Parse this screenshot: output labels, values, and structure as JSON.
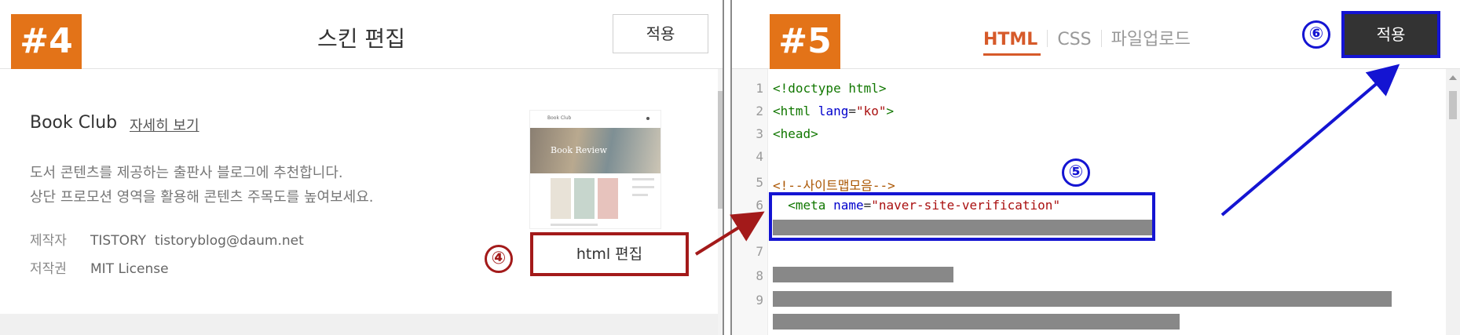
{
  "left_panel": {
    "step_tag": "#4",
    "title": "스킨 편집",
    "apply_label": "적용",
    "skin": {
      "name": "Book Club",
      "detail_link": "자세히 보기",
      "description": [
        "도서 콘텐츠를 제공하는 출판사 블로그에 추천합니다.",
        "상단 프로모션 영역을 활용해 콘텐츠 주목도를 높여보세요."
      ],
      "meta": [
        {
          "label": "제작자",
          "value": "TISTORY  tistoryblog@daum.net"
        },
        {
          "label": "저작권",
          "value": "MIT License"
        }
      ]
    },
    "thumbnail": {
      "header_text": "Book Club",
      "hero_text": "Book Review"
    },
    "html_edit_label": "html 편집",
    "callout": "④"
  },
  "right_panel": {
    "step_tag": "#5",
    "tabs": [
      {
        "label": "HTML",
        "active": true
      },
      {
        "label": "CSS",
        "active": false
      },
      {
        "label": "파일업로드",
        "active": false
      }
    ],
    "apply_label": "적용",
    "callout_apply": "⑥",
    "callout_box": "⑤",
    "code_lines": [
      {
        "num": "1",
        "text": "<!doctype html>"
      },
      {
        "num": "2",
        "text": "<html lang=\"ko\">"
      },
      {
        "num": "3",
        "text": "<head>"
      },
      {
        "num": "4",
        "text": ""
      },
      {
        "num": "5",
        "text": "<!--사이트맵모음-->"
      },
      {
        "num": "6",
        "text": "  <meta name=\"naver-site-verification\""
      },
      {
        "num": "7",
        "text": ""
      },
      {
        "num": "8",
        "text": ""
      },
      {
        "num": "9",
        "text": ""
      }
    ]
  },
  "colors": {
    "step_tag": "#e37318",
    "callout_red": "#a31a1a",
    "callout_blue": "#1414d2",
    "active_tab": "#d65a2a"
  }
}
